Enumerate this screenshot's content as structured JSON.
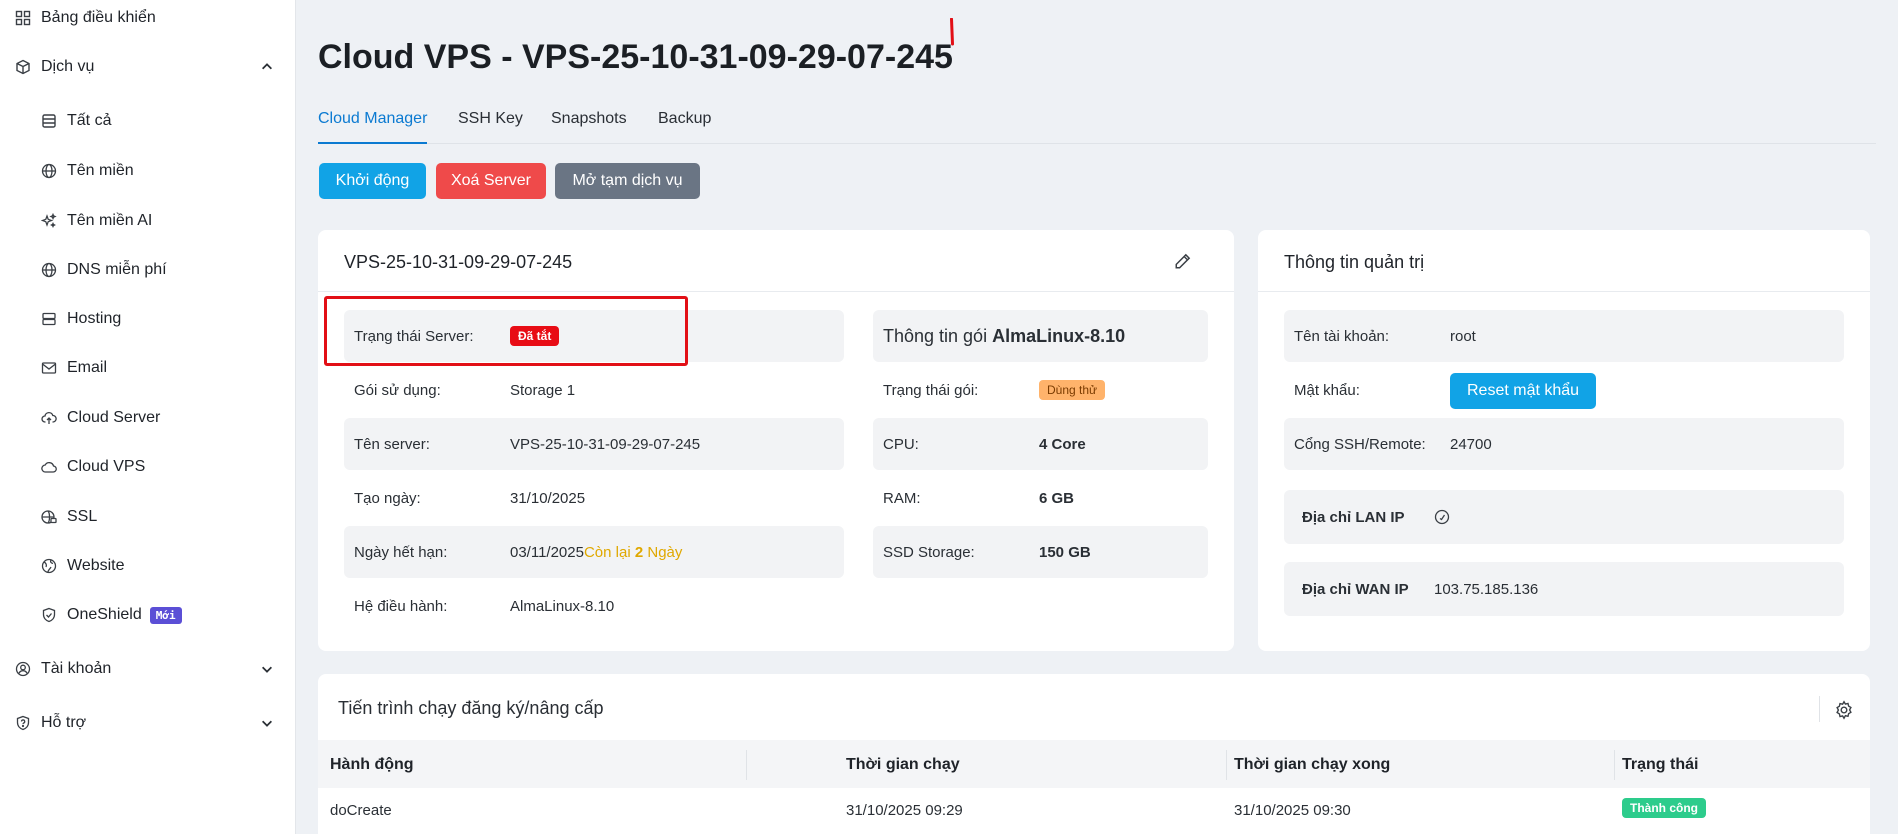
{
  "sidebar": {
    "items": [
      {
        "label": "Bảng điều khiển"
      },
      {
        "label": "Dịch vụ"
      },
      {
        "label": "Tất cả"
      },
      {
        "label": "Tên miền"
      },
      {
        "label": "Tên miền AI"
      },
      {
        "label": "DNS miễn phí"
      },
      {
        "label": "Hosting"
      },
      {
        "label": "Email"
      },
      {
        "label": "Cloud Server"
      },
      {
        "label": "Cloud VPS"
      },
      {
        "label": "SSL"
      },
      {
        "label": "Website"
      },
      {
        "label": "OneShield",
        "badge": "Mới"
      },
      {
        "label": "Tài khoản"
      },
      {
        "label": "Hỗ trợ"
      }
    ]
  },
  "page": {
    "title": "Cloud VPS - VPS-25-10-31-09-29-07-245"
  },
  "tabs": [
    "Cloud Manager",
    "SSH Key",
    "Snapshots",
    "Backup"
  ],
  "actions": {
    "start": "Khởi động",
    "delete": "Xoá Server",
    "unlock": "Mở tạm dịch vụ"
  },
  "server_card": {
    "title": "VPS-25-10-31-09-29-07-245",
    "status_label": "Trạng thái Server:",
    "status_value": "Đã tắt",
    "plan_label": "Gói sử dụng:",
    "plan_value": "Storage 1",
    "name_label": "Tên server:",
    "name_value": "VPS-25-10-31-09-29-07-245",
    "created_label": "Tạo ngày:",
    "created_value": "31/10/2025",
    "expire_label": "Ngày hết hạn:",
    "expire_date": "03/11/2025",
    "remaining_prefix": "Còn lại",
    "remaining_days": "2",
    "remaining_suffix": "Ngày",
    "os_label": "Hệ điều hành:",
    "os_value": "AlmaLinux-8.10",
    "package_title_prefix": "Thông tin gói",
    "package_title_name": "AlmaLinux-8.10",
    "package_status_label": "Trạng thái gói:",
    "package_status_value": "Dùng thử",
    "cpu_label": "CPU:",
    "cpu_value": "4 Core",
    "ram_label": "RAM:",
    "ram_value": "6 GB",
    "ssd_label": "SSD Storage:",
    "ssd_value": "150 GB"
  },
  "admin_card": {
    "title": "Thông tin quản trị",
    "account_label": "Tên tài khoản:",
    "account_value": "root",
    "password_label": "Mật khẩu:",
    "reset_button": "Reset mật khẩu",
    "ssh_label": "Cổng SSH/Remote:",
    "ssh_value": "24700",
    "lan_label": "Địa chỉ LAN IP",
    "wan_label": "Địa chỉ WAN IP",
    "wan_value": "103.75.185.136"
  },
  "process_card": {
    "title": "Tiến trình chạy đăng ký/nâng cấp",
    "columns": [
      "Hành động",
      "Thời gian chạy",
      "Thời gian chạy xong",
      "Trạng thái"
    ],
    "rows": [
      {
        "action": "doCreate",
        "start": "31/10/2025 09:29",
        "end": "31/10/2025 09:30",
        "status": "Thành công"
      }
    ]
  },
  "colors": {
    "accent": "#0b7ad1",
    "start_button": "#11a3e6",
    "delete_button": "#ef4a4a",
    "unlock_button": "#6a7584",
    "status_off": "#e80c15",
    "trial": "#ffb36b",
    "success": "#2dcc8c",
    "remaining": "#e0a800",
    "highlight": "#e20f16"
  }
}
